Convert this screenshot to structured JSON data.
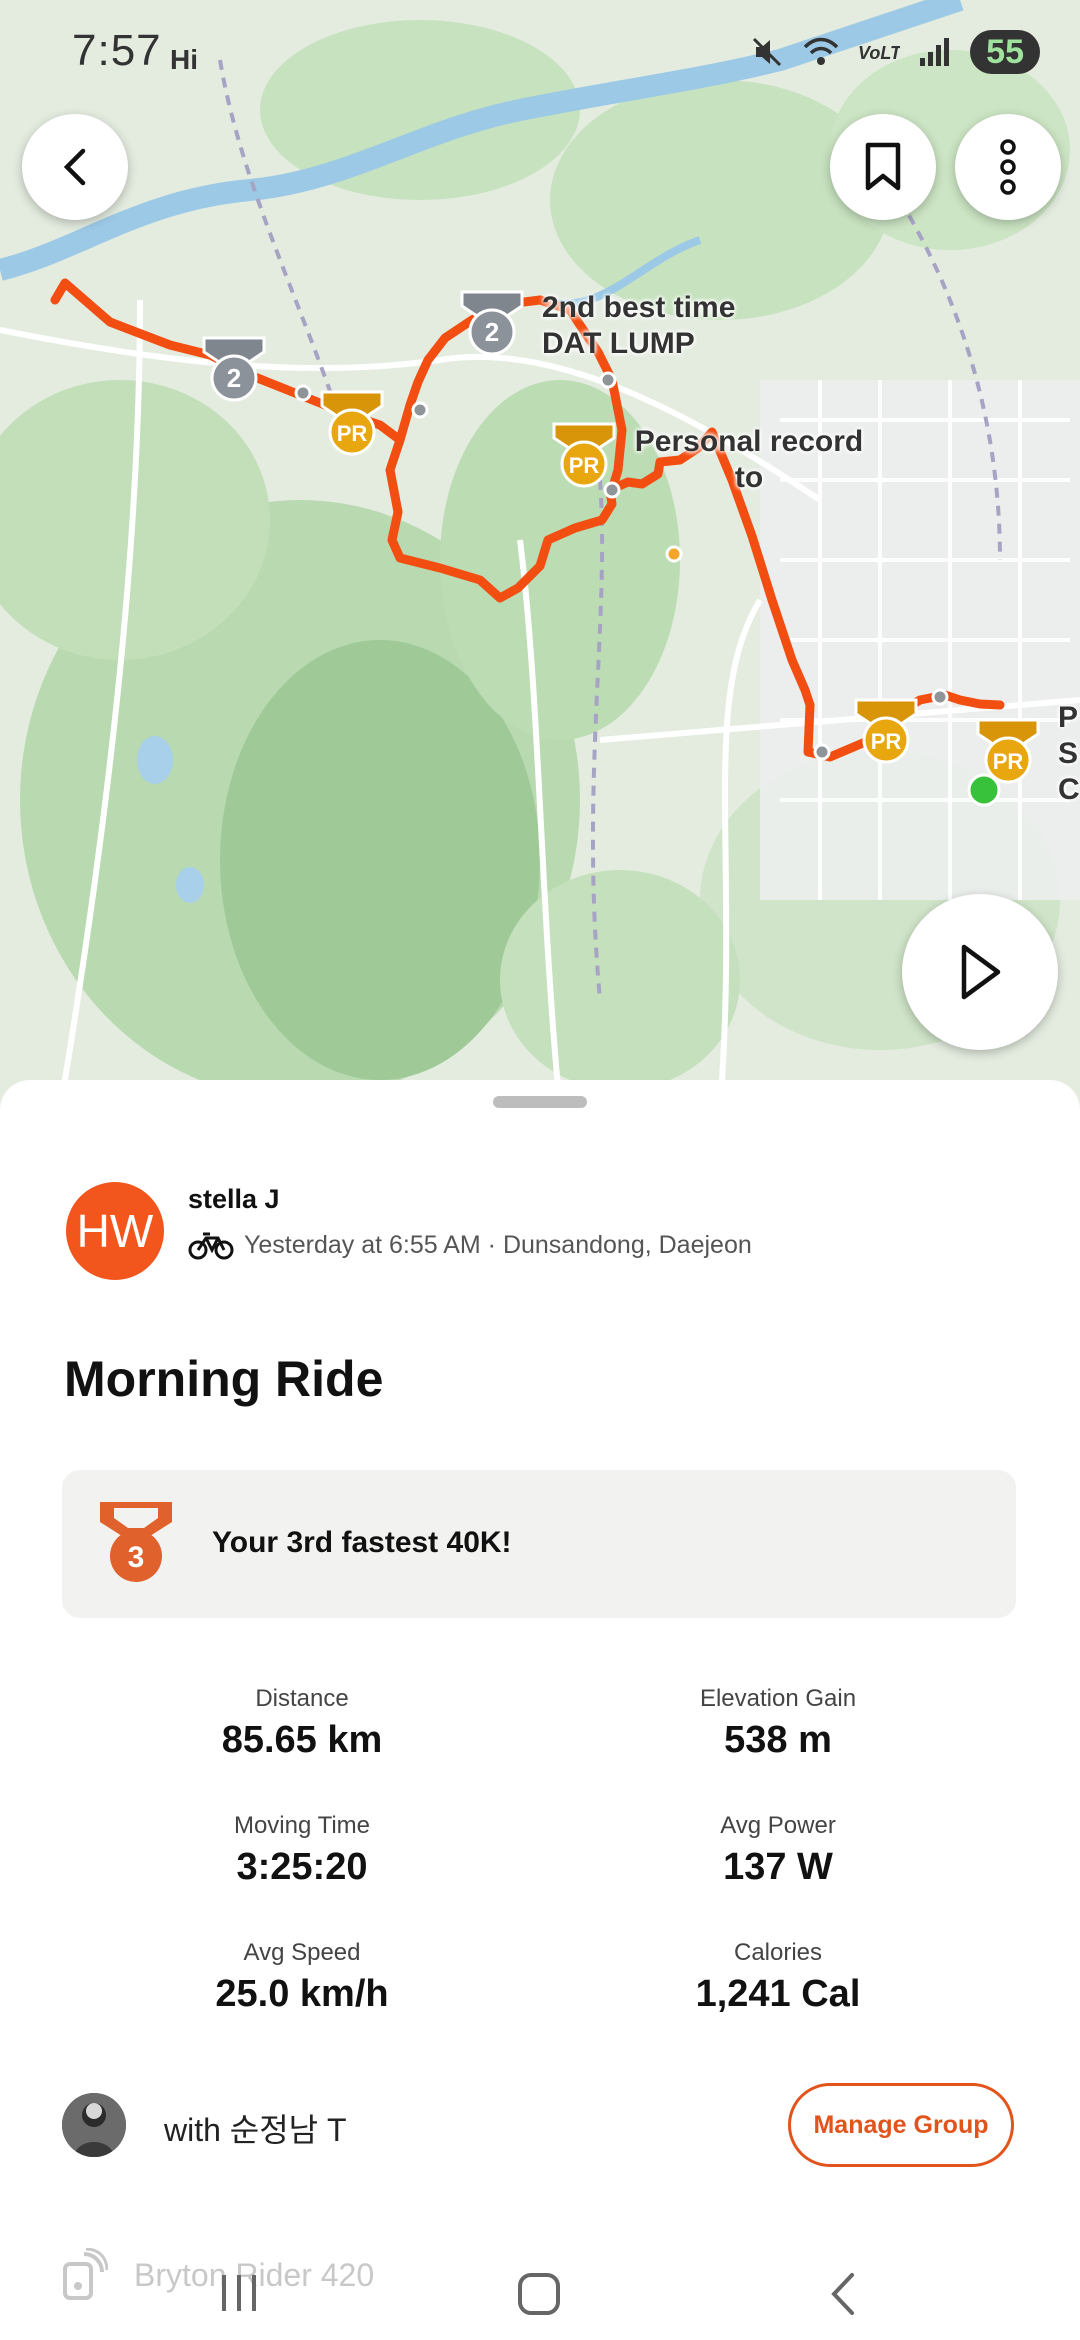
{
  "status_bar": {
    "time": "7:57",
    "carrier_tag": "Hi",
    "battery": "55",
    "icons": [
      "mute-icon",
      "wifi-icon",
      "volte-icon",
      "signal-icon",
      "battery-icon"
    ]
  },
  "map": {
    "labels": {
      "second_best": "2nd best time",
      "segment_name": "DAT LUMP",
      "pr_line1": "Personal record",
      "pr_line2": "to",
      "edge_letters": [
        "P",
        "S",
        "C"
      ]
    },
    "medal_texts": {
      "second": "2",
      "pr": "PR"
    },
    "colors": {
      "route": "#f24e12",
      "pr_medal": "#e8a60f",
      "silver_medal": "#8c9299"
    }
  },
  "header_buttons": [
    "back-icon",
    "bookmark-icon",
    "more-icon",
    "play-icon"
  ],
  "activity": {
    "avatar_initials": "HW",
    "athlete_name": "stella J",
    "meta": "Yesterday at 6:55 AM · Dunsandong, Daejeon",
    "title": "Morning Ride",
    "achievement": {
      "rank": "3",
      "text": "Your 3rd fastest 40K!"
    }
  },
  "stats": [
    {
      "label": "Distance",
      "value": "85.65 km"
    },
    {
      "label": "Elevation Gain",
      "value": "538 m"
    },
    {
      "label": "Moving Time",
      "value": "3:25:20"
    },
    {
      "label": "Avg Power",
      "value": "137 W"
    },
    {
      "label": "Avg Speed",
      "value": "25.0 km/h"
    },
    {
      "label": "Calories",
      "value": "1,241 Cal"
    }
  ],
  "group": {
    "with_text": "with 순정남 T",
    "manage_label": "Manage Group"
  },
  "device": {
    "name": "Bryton Rider 420"
  },
  "accent": "#e2541c"
}
